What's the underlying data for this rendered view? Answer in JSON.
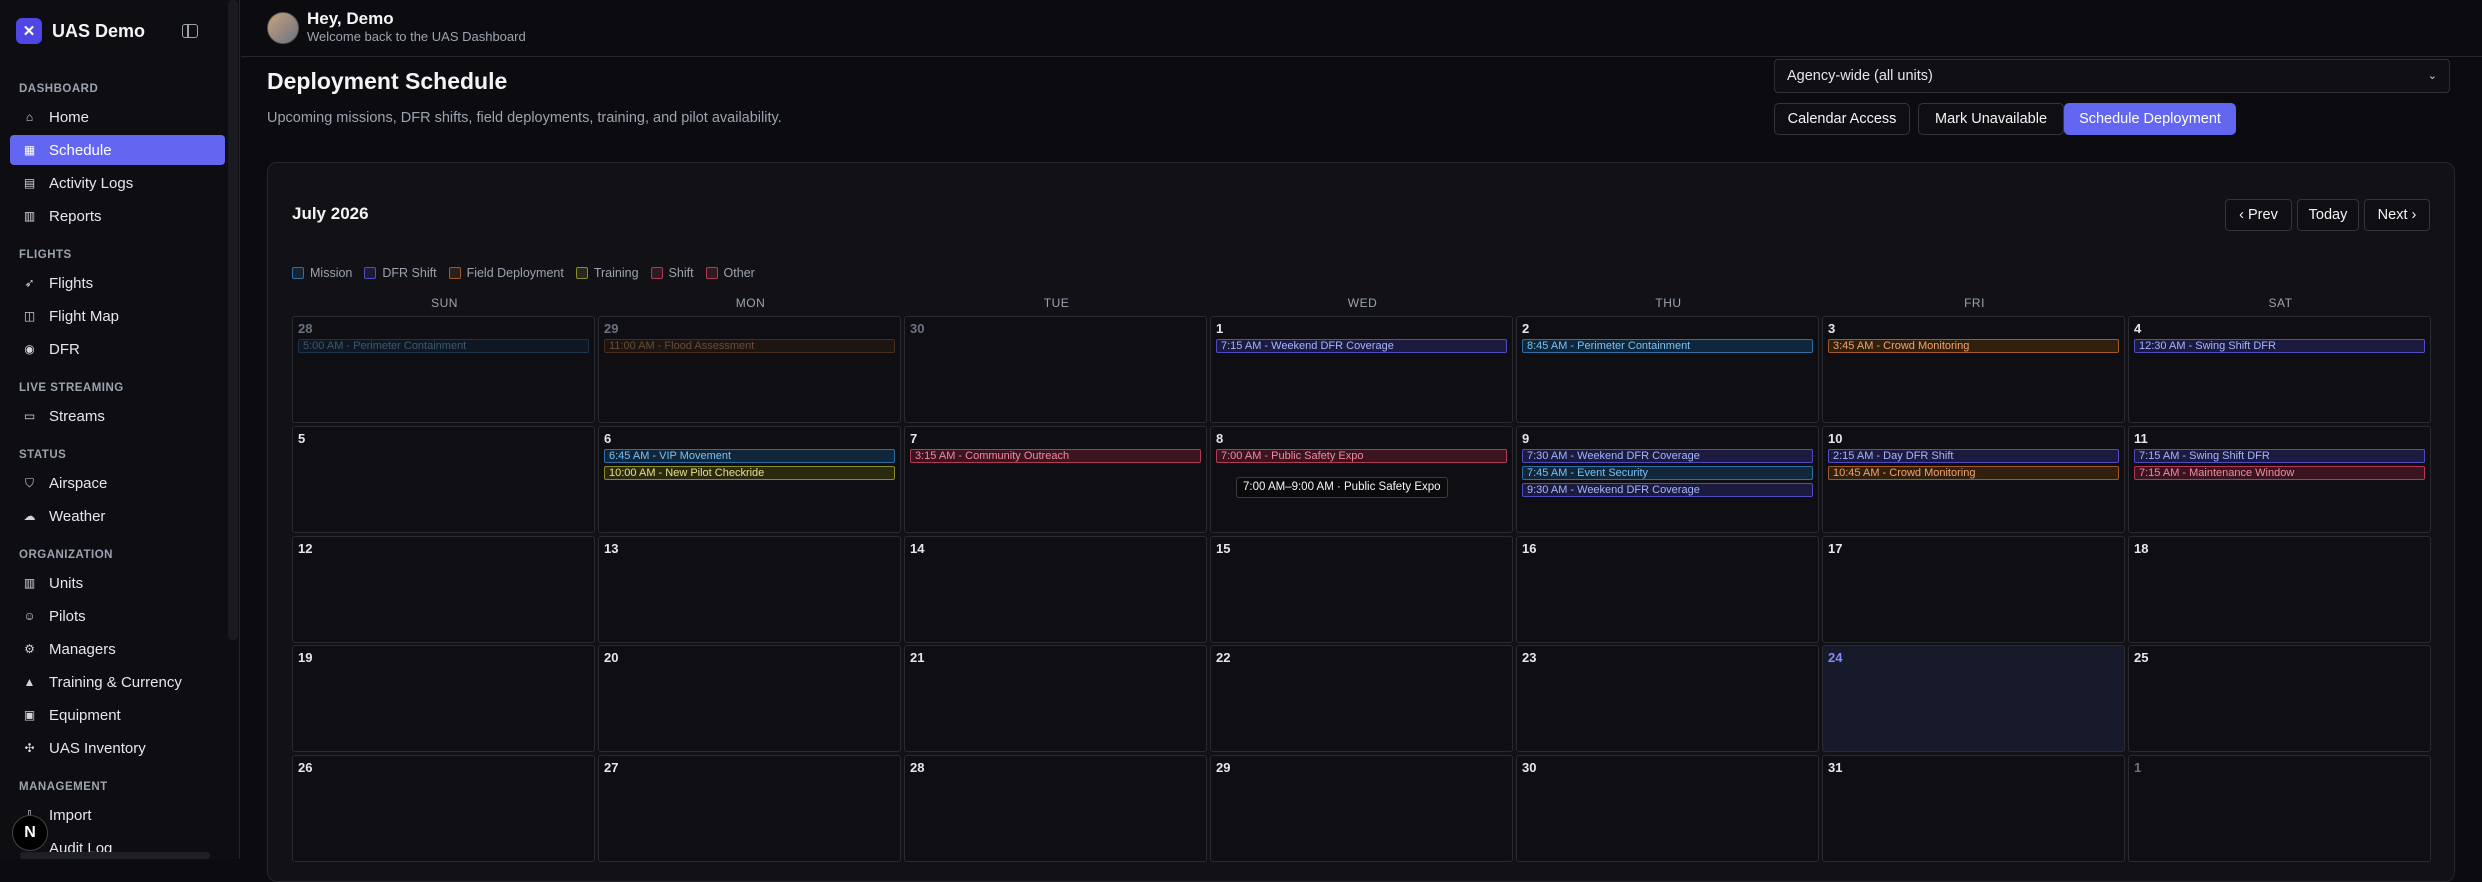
{
  "brand": {
    "name": "UAS Demo",
    "logo_icon": "drone-logo-icon"
  },
  "sidebar": {
    "sections": [
      {
        "title": "DASHBOARD",
        "items": [
          {
            "label": "Home",
            "icon": "home-icon"
          },
          {
            "label": "Schedule",
            "icon": "calendar-icon",
            "active": true
          },
          {
            "label": "Activity Logs",
            "icon": "clipboard-icon"
          },
          {
            "label": "Reports",
            "icon": "file-icon"
          }
        ]
      },
      {
        "title": "FLIGHTS",
        "items": [
          {
            "label": "Flights",
            "icon": "rocket-icon"
          },
          {
            "label": "Flight Map",
            "icon": "map-icon"
          },
          {
            "label": "DFR",
            "icon": "broadcast-icon"
          }
        ]
      },
      {
        "title": "LIVE STREAMING",
        "items": [
          {
            "label": "Streams",
            "icon": "video-icon"
          }
        ]
      },
      {
        "title": "STATUS",
        "items": [
          {
            "label": "Airspace",
            "icon": "shield-icon"
          },
          {
            "label": "Weather",
            "icon": "weather-icon"
          }
        ]
      },
      {
        "title": "ORGANIZATION",
        "items": [
          {
            "label": "Units",
            "icon": "building-icon"
          },
          {
            "label": "Pilots",
            "icon": "users-icon"
          },
          {
            "label": "Managers",
            "icon": "user-cog-icon"
          },
          {
            "label": "Training & Currency",
            "icon": "graduation-icon"
          },
          {
            "label": "Equipment",
            "icon": "box-icon"
          },
          {
            "label": "UAS Inventory",
            "icon": "drone-icon"
          }
        ]
      },
      {
        "title": "MANAGEMENT",
        "items": [
          {
            "label": "Import",
            "icon": "import-icon"
          },
          {
            "label": "Audit Log",
            "icon": "list-icon"
          }
        ]
      }
    ],
    "bottom_avatar_letter": "N"
  },
  "header": {
    "greeting": "Hey, Demo",
    "welcome": "Welcome back to the UAS Dashboard"
  },
  "page": {
    "title": "Deployment Schedule",
    "subtitle": "Upcoming missions, DFR shifts, field deployments, training, and pilot availability.",
    "agency_select": "Agency-wide (all units)",
    "buttons": {
      "calendar_access": "Calendar Access",
      "mark_unavailable": "Mark Unavailable",
      "schedule_deployment": "Schedule Deployment"
    }
  },
  "calendar": {
    "month_label": "July 2026",
    "nav": {
      "prev": "‹ Prev",
      "today": "Today",
      "next": "Next ›"
    },
    "legend": [
      {
        "label": "Mission",
        "color": "#2f6fa5"
      },
      {
        "label": "DFR Shift",
        "color": "#4f4cc4"
      },
      {
        "label": "Field Deployment",
        "color": "#a05a2a"
      },
      {
        "label": "Training",
        "color": "#8a8a2a"
      },
      {
        "label": "Shift",
        "color": "#b23a55"
      },
      {
        "label": "Other",
        "color": "#b23a55"
      }
    ],
    "weekdays": [
      "SUN",
      "MON",
      "TUE",
      "WED",
      "THU",
      "FRI",
      "SAT"
    ],
    "weeks": [
      [
        {
          "day": "28",
          "outside": true,
          "events": [
            {
              "text": "5:00 AM - Perimeter Containment",
              "type": "mission"
            }
          ]
        },
        {
          "day": "29",
          "outside": true,
          "events": [
            {
              "text": "11:00 AM - Flood Assessment",
              "type": "field"
            }
          ]
        },
        {
          "day": "30",
          "outside": true,
          "events": []
        },
        {
          "day": "1",
          "events": [
            {
              "text": "7:15 AM - Weekend DFR Coverage",
              "type": "dfr"
            }
          ]
        },
        {
          "day": "2",
          "events": [
            {
              "text": "8:45 AM - Perimeter Containment",
              "type": "mission"
            }
          ]
        },
        {
          "day": "3",
          "events": [
            {
              "text": "3:45 AM - Crowd Monitoring",
              "type": "field"
            }
          ]
        },
        {
          "day": "4",
          "events": [
            {
              "text": "12:30 AM - Swing Shift DFR",
              "type": "dfr"
            }
          ]
        }
      ],
      [
        {
          "day": "5",
          "events": []
        },
        {
          "day": "6",
          "events": [
            {
              "text": "6:45 AM - VIP Movement",
              "type": "mission"
            },
            {
              "text": "10:00 AM - New Pilot Checkride",
              "type": "training"
            }
          ]
        },
        {
          "day": "7",
          "events": [
            {
              "text": "3:15 AM - Community Outreach",
              "type": "other"
            }
          ]
        },
        {
          "day": "8",
          "events": [
            {
              "text": "7:00 AM - Public Safety Expo",
              "type": "other"
            }
          ]
        },
        {
          "day": "9",
          "events": [
            {
              "text": "7:30 AM - Weekend DFR Coverage",
              "type": "dfr"
            },
            {
              "text": "7:45 AM - Event Security",
              "type": "mission"
            },
            {
              "text": "9:30 AM - Weekend DFR Coverage",
              "type": "dfr"
            }
          ]
        },
        {
          "day": "10",
          "events": [
            {
              "text": "2:15 AM - Day DFR Shift",
              "type": "dfr"
            },
            {
              "text": "10:45 AM - Crowd Monitoring",
              "type": "field"
            }
          ]
        },
        {
          "day": "11",
          "events": [
            {
              "text": "7:15 AM - Swing Shift DFR",
              "type": "dfr"
            },
            {
              "text": "7:15 AM - Maintenance Window",
              "type": "shift"
            }
          ]
        }
      ],
      [
        {
          "day": "12",
          "events": []
        },
        {
          "day": "13",
          "events": []
        },
        {
          "day": "14",
          "events": []
        },
        {
          "day": "15",
          "events": []
        },
        {
          "day": "16",
          "events": []
        },
        {
          "day": "17",
          "events": []
        },
        {
          "day": "18",
          "events": []
        }
      ],
      [
        {
          "day": "19",
          "events": []
        },
        {
          "day": "20",
          "events": []
        },
        {
          "day": "21",
          "events": []
        },
        {
          "day": "22",
          "events": []
        },
        {
          "day": "23",
          "events": []
        },
        {
          "day": "24",
          "today": true,
          "events": []
        },
        {
          "day": "25",
          "events": []
        }
      ],
      [
        {
          "day": "26",
          "events": []
        },
        {
          "day": "27",
          "events": []
        },
        {
          "day": "28",
          "events": []
        },
        {
          "day": "29",
          "events": []
        },
        {
          "day": "30",
          "events": []
        },
        {
          "day": "31",
          "events": []
        },
        {
          "day": "1",
          "outside": true,
          "events": []
        }
      ]
    ],
    "tooltip": "7:00 AM–9:00 AM · Public Safety Expo"
  }
}
